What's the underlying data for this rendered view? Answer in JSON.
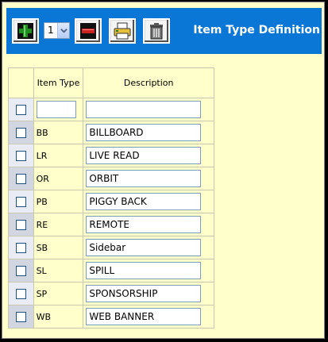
{
  "toolbar": {
    "title": "Item Type Definition",
    "row_count_value": "1",
    "icons": {
      "add": "plus-icon",
      "remove": "minus-icon",
      "print": "printer-icon",
      "delete": "trash-icon"
    },
    "colors": {
      "bar": "#0a77d7",
      "add": "#1f8f1f",
      "remove": "#cc2222"
    }
  },
  "grid": {
    "headers": {
      "item_type": "Item Type",
      "description": "Description"
    },
    "new_row": {
      "item_type": "",
      "description": ""
    },
    "rows": [
      {
        "code": "BB",
        "description": "BILLBOARD"
      },
      {
        "code": "LR",
        "description": "LIVE READ"
      },
      {
        "code": "OR",
        "description": "ORBIT"
      },
      {
        "code": "PB",
        "description": "PIGGY BACK"
      },
      {
        "code": "RE",
        "description": "REMOTE"
      },
      {
        "code": "SB",
        "description": "Sidebar"
      },
      {
        "code": "SL",
        "description": "SPILL"
      },
      {
        "code": "SP",
        "description": "SPONSORSHIP"
      },
      {
        "code": "WB",
        "description": "WEB BANNER"
      }
    ]
  },
  "background_color": "#ffffcc"
}
